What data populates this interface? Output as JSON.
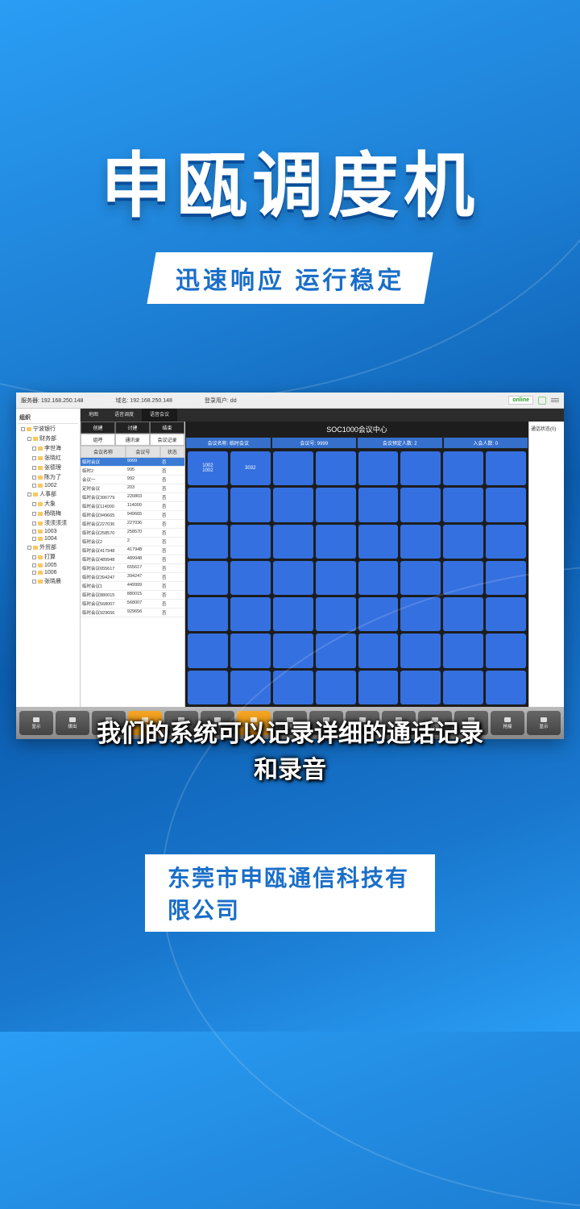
{
  "hero": {
    "title": "申瓯调度机",
    "subtitle": "迅速响应 运行稳定"
  },
  "caption": "我们的系统可以记录详细的通话记录\n和录音",
  "company": "东莞市申瓯通信科技有限公司",
  "app": {
    "topbar": {
      "server_label": "服务器: 192.168.250.148",
      "domain_label": "域名: 192.168.250.148",
      "login_label": "登录用户: dd",
      "online": "online"
    },
    "tree": {
      "head": "组织",
      "root": "宁波银行",
      "items": [
        {
          "label": "财务部",
          "lvl": 1
        },
        {
          "label": "李世海",
          "lvl": 2
        },
        {
          "label": "张晓红",
          "lvl": 2
        },
        {
          "label": "张德理",
          "lvl": 2
        },
        {
          "label": "陈为了",
          "lvl": 2
        },
        {
          "label": "1002",
          "lvl": 2
        },
        {
          "label": "人事部",
          "lvl": 1
        },
        {
          "label": "大象",
          "lvl": 2
        },
        {
          "label": "杨晓梅",
          "lvl": 2
        },
        {
          "label": "须须须须",
          "lvl": 2
        },
        {
          "label": "1003",
          "lvl": 2
        },
        {
          "label": "1004",
          "lvl": 2
        },
        {
          "label": "外贸部",
          "lvl": 1
        },
        {
          "label": "打算",
          "lvl": 2
        },
        {
          "label": "1005",
          "lvl": 2
        },
        {
          "label": "1006",
          "lvl": 2
        },
        {
          "label": "张晓晨",
          "lvl": 2
        }
      ]
    },
    "tabs": [
      "地图",
      "语音调度",
      "语音会议"
    ],
    "list": {
      "actions_row1": [
        "创建",
        "讨建",
        "结束"
      ],
      "actions_row2": [
        "组呼",
        "通讯录",
        "会议记录"
      ],
      "columns": [
        "会议名称",
        "会议号",
        "状态"
      ],
      "rows": [
        {
          "name": "临时会议",
          "num": "9999",
          "state": "否",
          "sel": true
        },
        {
          "name": "临时2",
          "num": "995",
          "state": "否"
        },
        {
          "name": "会议一",
          "num": "992",
          "state": "否"
        },
        {
          "name": "定时会议",
          "num": "203",
          "state": "否"
        },
        {
          "name": "临时会议396779",
          "num": "220803",
          "state": "否"
        },
        {
          "name": "临时会议114000",
          "num": "114000",
          "state": "否"
        },
        {
          "name": "临时会议949665",
          "num": "949665",
          "state": "否"
        },
        {
          "name": "临时会议227036",
          "num": "227036",
          "state": "否"
        },
        {
          "name": "临时会议258570",
          "num": "258570",
          "state": "否"
        },
        {
          "name": "临时会议2",
          "num": "2",
          "state": "否"
        },
        {
          "name": "临时会议417948",
          "num": "417948",
          "state": "否"
        },
        {
          "name": "临时会议489948",
          "num": "489948",
          "state": "否"
        },
        {
          "name": "临时会议655617",
          "num": "655617",
          "state": "否"
        },
        {
          "name": "临时会议394247",
          "num": "394247",
          "state": "否"
        },
        {
          "name": "临时会议1",
          "num": "449999",
          "state": "否"
        },
        {
          "name": "临时会议880015",
          "num": "880015",
          "state": "否"
        },
        {
          "name": "临时会议568007",
          "num": "568007",
          "state": "否"
        },
        {
          "name": "临时会议929656",
          "num": "929656",
          "state": "否"
        }
      ]
    },
    "grid": {
      "title": "SOC1000会议中心",
      "stats": [
        "会议名称: 临时会议",
        "会议号: 9999",
        "会议预定人数: 2",
        "入会人数: 0"
      ],
      "first_cell": {
        "line1": "1002",
        "line2": "1002"
      },
      "second_cell": "3032"
    },
    "right_panel": "通话状态(0)",
    "bottom_buttons": [
      "显示",
      "拨出",
      "监听",
      "点名",
      "插话",
      "举手",
      "通话记录",
      "转移人",
      "请离",
      "紧急呼叫",
      "无条件代接",
      "代接",
      "转移",
      "抢接",
      "显示"
    ]
  }
}
